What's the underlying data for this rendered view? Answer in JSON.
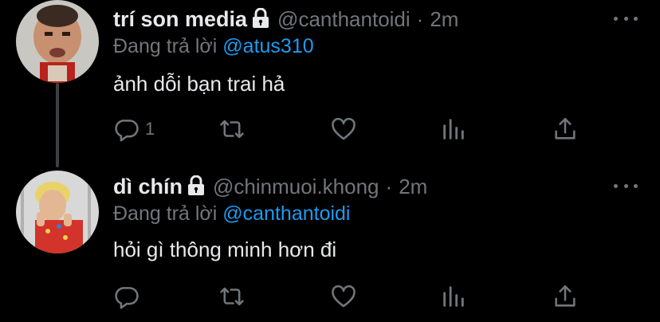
{
  "tweets": [
    {
      "display_name": "trí son media",
      "handle": "@canthantoidi",
      "separator": "·",
      "time": "2m",
      "reply_prefix": "Đang trả lời ",
      "reply_to": "@atus310",
      "text": "ảnh dỗi bạn trai hả",
      "reply_count": "1",
      "avatar_icon": "avatar-photo",
      "locked": true
    },
    {
      "display_name": "dì chín",
      "handle": "@chinmuoi.khong",
      "separator": "·",
      "time": "2m",
      "reply_prefix": "Đang trả lời ",
      "reply_to": "@canthantoidi",
      "text": "hỏi gì thông minh hơn đi",
      "reply_count": "",
      "avatar_icon": "avatar-photo",
      "locked": true
    }
  ],
  "colors": {
    "background": "#000000",
    "primary_text": "#e7e9ea",
    "secondary_text": "#71767b",
    "mention": "#1d9bf0"
  }
}
